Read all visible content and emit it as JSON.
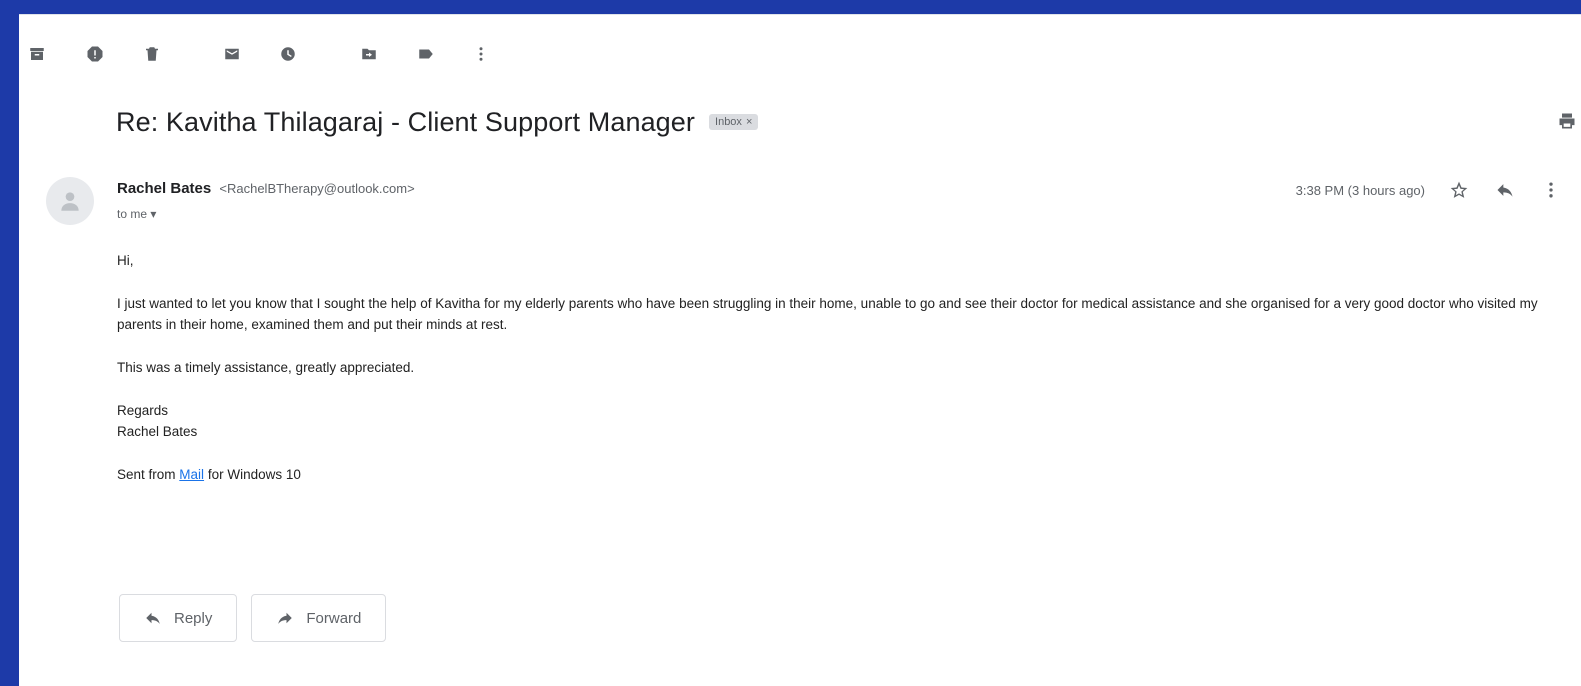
{
  "subject": "Re: Kavitha Thilagaraj - Client Support Manager",
  "label_chip": "Inbox",
  "sender": {
    "name": "Rachel Bates",
    "email": "<RachelBTherapy@outlook.com>",
    "to": "to me"
  },
  "timestamp": "3:38 PM (3 hours ago)",
  "body": {
    "greeting": "Hi,",
    "paragraph1": "I just wanted to let you know that I sought the help of Kavitha for my elderly parents who have been struggling in their home, unable to go and see their doctor for medical assistance and she organised for a very good doctor who visited my parents in their home, examined them and put their minds at rest.",
    "paragraph2": "This was a timely assistance, greatly appreciated.",
    "signoff": "Regards",
    "signature": "Rachel Bates",
    "sent_prefix": "Sent from",
    "sent_link": "Mail",
    "sent_suffix": "for Windows 10"
  },
  "actions": {
    "reply_label": "Reply",
    "forward_label": "Forward"
  },
  "icons": {
    "toolbar": [
      "archive-icon",
      "report-spam-icon",
      "delete-icon",
      "mark-unread-icon",
      "snooze-icon",
      "move-to-icon",
      "labels-icon",
      "more-vert-icon"
    ]
  }
}
